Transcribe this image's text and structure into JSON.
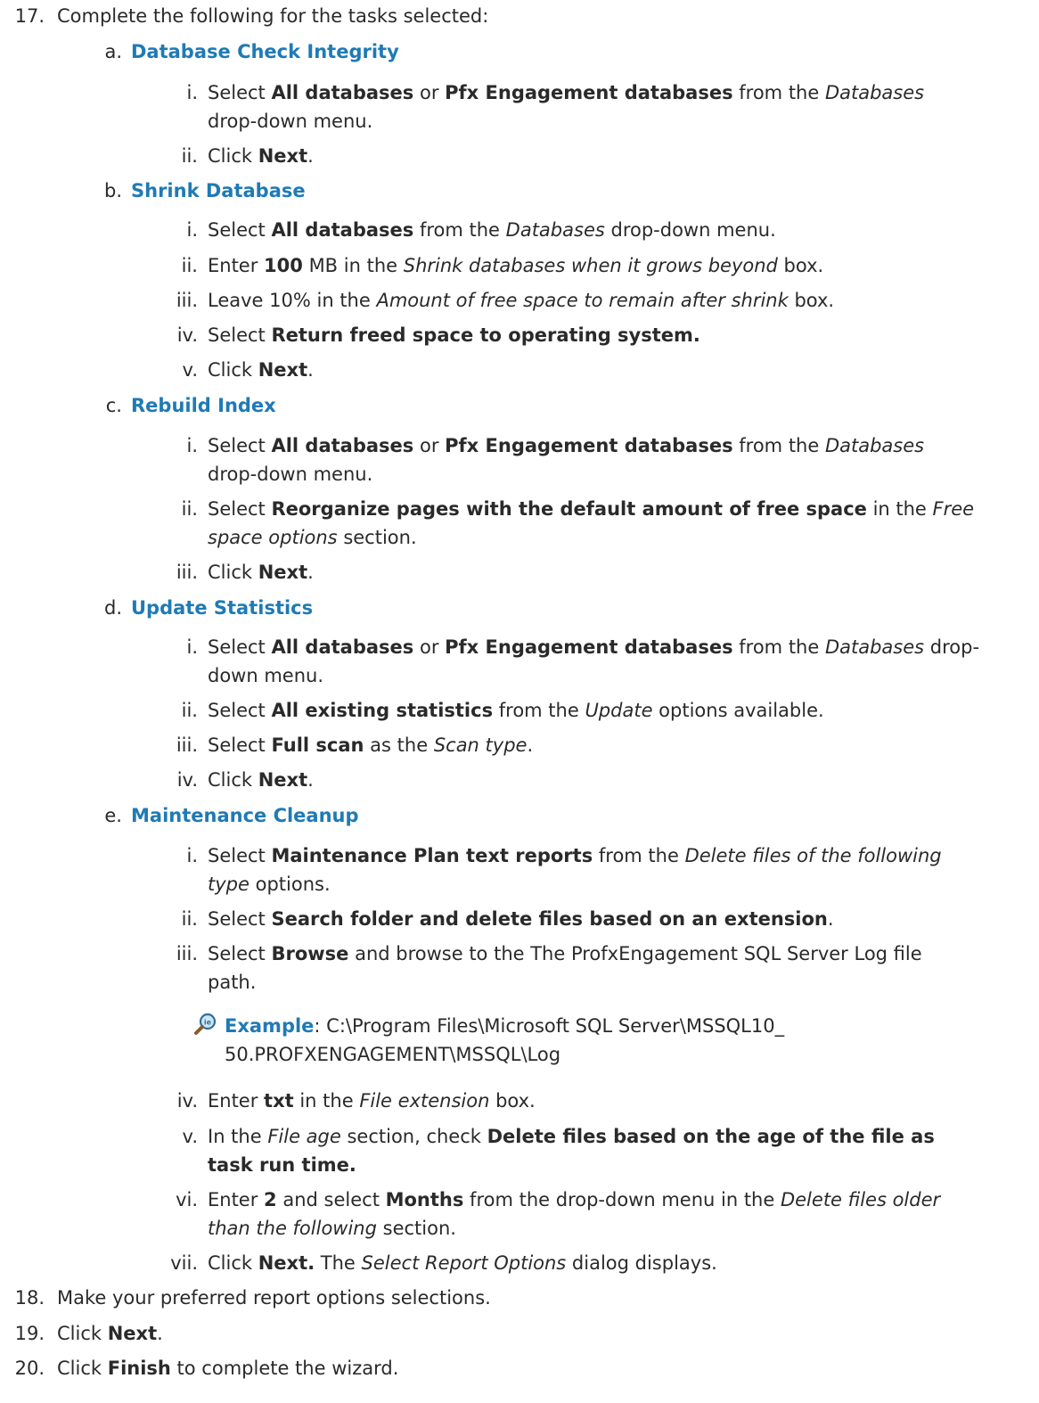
{
  "steps": {
    "s17": {
      "num": "17.",
      "text": "Complete the following for the tasks selected:"
    },
    "a": {
      "letter": "a.",
      "heading": "Database Check Integrity",
      "i": {
        "num": "i.",
        "t1": "Select ",
        "b1": "All databases",
        "t2": " or ",
        "b2": "Pfx Engagement databases",
        "t3": " from the ",
        "em1": "Databases",
        "line2": "drop-down menu."
      },
      "ii": {
        "num": "ii.",
        "t1": "Click ",
        "b1": "Next",
        "t2": "."
      }
    },
    "b": {
      "letter": "b.",
      "heading": "Shrink Database",
      "i": {
        "num": "i.",
        "t1": "Select ",
        "b1": "All databases",
        "t2": " from the ",
        "em1": "Databases",
        "t3": " drop-down menu."
      },
      "ii": {
        "num": "ii.",
        "t1": "Enter ",
        "b1": "100",
        "t2": " MB in the ",
        "em1": "Shrink databases when it grows beyond",
        "t3": " box."
      },
      "iii": {
        "num": "iii.",
        "t1": "Leave 10% in the ",
        "em1": "Amount of free space to remain after shrink",
        "t2": " box."
      },
      "iv": {
        "num": "iv.",
        "t1": "Select ",
        "b1": "Return freed space to operating system."
      },
      "v": {
        "num": "v.",
        "t1": "Click ",
        "b1": "Next",
        "t2": "."
      }
    },
    "c": {
      "letter": "c.",
      "heading": "Rebuild Index",
      "i": {
        "num": "i.",
        "t1": "Select ",
        "b1": "All databases",
        "t2": " or ",
        "b2": "Pfx Engagement databases",
        "t3": " from the ",
        "em1": "Databases",
        "line2": "drop-down menu."
      },
      "ii": {
        "num": "ii.",
        "t1": "Select ",
        "b1": "Reorganize pages with the default amount of free space",
        "t2": " in the ",
        "em1": "Free",
        "em2": "space options",
        "t3": " section."
      },
      "iii": {
        "num": "iii.",
        "t1": "Click ",
        "b1": "Next",
        "t2": "."
      }
    },
    "d": {
      "letter": "d.",
      "heading": "Update Statistics",
      "i": {
        "num": "i.",
        "t1": "Select ",
        "b1": "All databases",
        "t2": " or ",
        "b2": "Pfx Engagement databases",
        "t3": " from the ",
        "em1": "Databases",
        "t4": " drop-",
        "line2": "down menu."
      },
      "ii": {
        "num": "ii.",
        "t1": "Select ",
        "b1": "All existing statistics",
        "t2": " from the ",
        "em1": "Update",
        "t3": " options available."
      },
      "iii": {
        "num": "iii.",
        "t1": "Select ",
        "b1": "Full scan",
        "t2": " as the ",
        "em1": "Scan type",
        "t3": "."
      },
      "iv": {
        "num": "iv.",
        "t1": "Click ",
        "b1": "Next",
        "t2": "."
      }
    },
    "e": {
      "letter": "e.",
      "heading": "Maintenance Cleanup",
      "i": {
        "num": "i.",
        "t1": "Select ",
        "b1": "Maintenance Plan text reports",
        "t2": " from the ",
        "em1": "Delete files of the following",
        "em2": "type",
        "t3": " options."
      },
      "ii": {
        "num": "ii.",
        "t1": "Select ",
        "b1": "Search folder and delete files based on an extension",
        "t2": "."
      },
      "iii": {
        "num": "iii.",
        "t1": "Select ",
        "b1": "Browse",
        "t2": " and browse to the The ProfxEngagement SQL Server Log file",
        "line2": "path."
      },
      "example": {
        "label": "Example",
        "t1": ": C:\\Program Files\\Microsoft SQL Server\\MSSQL10_",
        "line2": "50.PROFXENGAGEMENT\\MSSQL\\Log",
        "icon": "magnifier-example-icon"
      },
      "iv": {
        "num": "iv.",
        "t1": "Enter ",
        "b1": "txt",
        "t2": " in the ",
        "em1": "File extension",
        "t3": " box."
      },
      "v": {
        "num": "v.",
        "t1": "In the ",
        "em1": "File age",
        "t2": " section, check ",
        "b1": "Delete files based on the age of the file as",
        "b2": "task run time."
      },
      "vi": {
        "num": "vi.",
        "t1": "Enter ",
        "b1": "2",
        "t2": " and select ",
        "b2": "Months",
        "t3": " from the drop-down menu in the ",
        "em1": "Delete files older",
        "em2": "than the following",
        "t4": " section."
      },
      "vii": {
        "num": "vii.",
        "t1": "Click ",
        "b1": "Next.",
        "t2": " The ",
        "em1": "Select Report Options",
        "t3": " dialog displays."
      }
    },
    "s18": {
      "num": "18.",
      "text": "Make your preferred report options selections."
    },
    "s19": {
      "num": "19.",
      "t1": "Click ",
      "b1": "Next",
      "t2": "."
    },
    "s20": {
      "num": "20.",
      "t1": "Click ",
      "b1": "Finish",
      "t2": " to complete the wizard."
    }
  },
  "colors": {
    "heading": "#1f7ab5",
    "text": "#2a2a2a"
  }
}
